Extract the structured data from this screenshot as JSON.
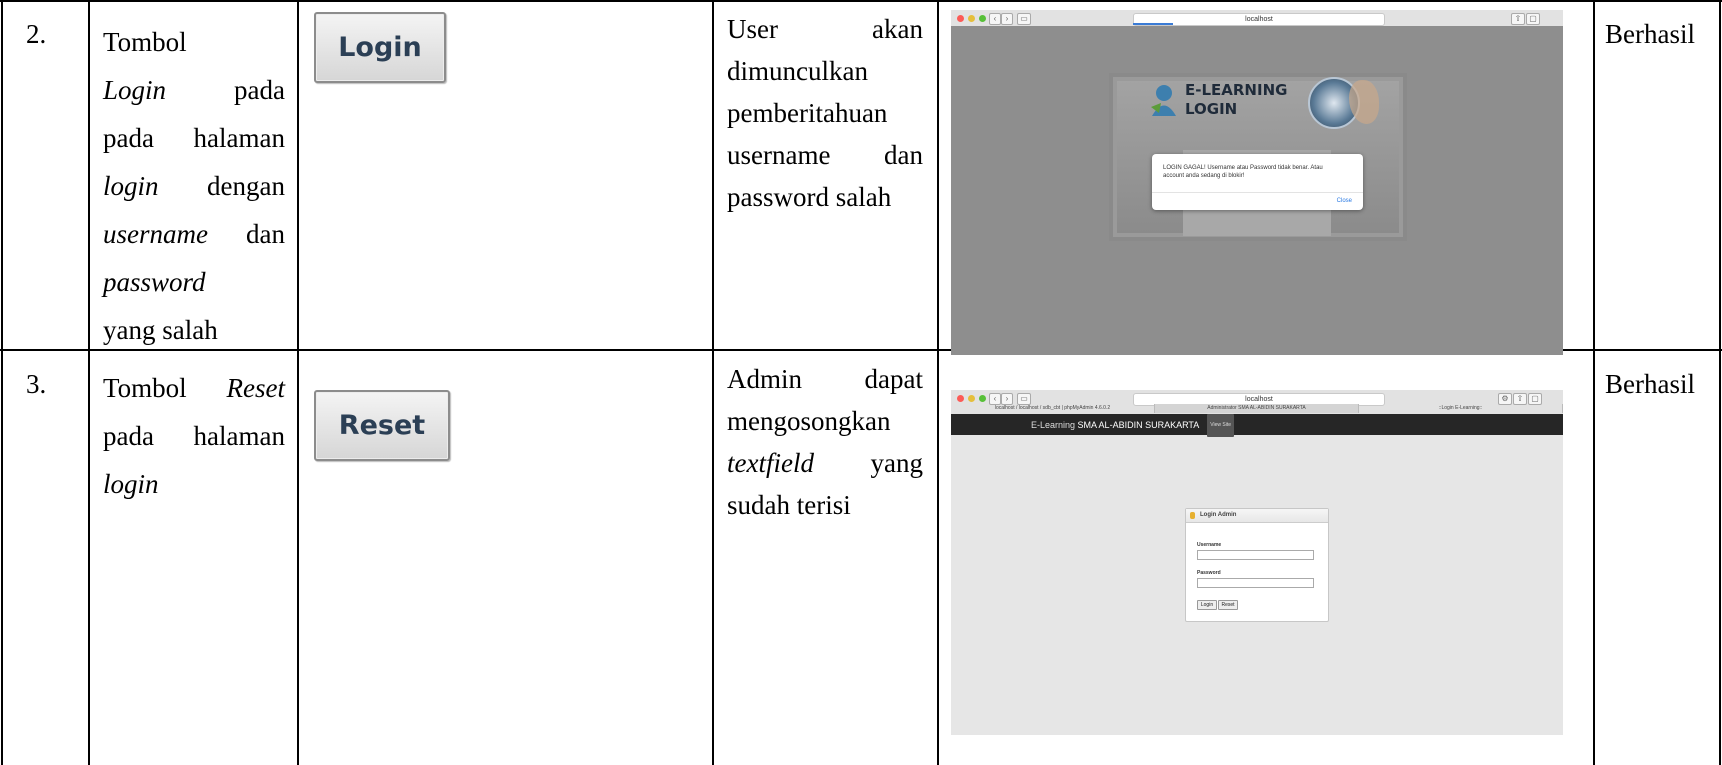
{
  "rows": [
    {
      "number": "2.",
      "test_case": {
        "line1": "Tombol",
        "line2_em": "Login",
        "line2_rest": "pada",
        "line3": "pada halaman",
        "line4_em": "login",
        "line4_rest": "dengan",
        "line5_em": "username",
        "line5_rest": "dan",
        "line6_em": "password",
        "line7": "yang salah"
      },
      "button_image_label": "Login",
      "expected": {
        "line1a": "User",
        "line1b": "akan",
        "line2": "dimunculkan",
        "line3": "pemberitahuan",
        "line4a": "username",
        "line4b": "dan",
        "line5": "password salah"
      },
      "screenshot": {
        "url": "localhost",
        "logo_line1": "E-LEARNING",
        "logo_line2": "LOGIN",
        "alert_message": "LOGIN GAGAL! Username atau Password tidak benar. Atau account anda sedang di blokir!",
        "alert_close": "Close"
      },
      "result": "Berhasil"
    },
    {
      "number": "3.",
      "test_case": {
        "line1_plain": "Tombol",
        "line1_em": "Reset",
        "line2": "pada halaman",
        "line3_em": "login"
      },
      "button_image_label": "Reset",
      "expected": {
        "line1a": "Admin",
        "line1b": "dapat",
        "line2": "mengosongkan",
        "line3_em": "textfield",
        "line3_rest": "yang",
        "line4": "sudah terisi"
      },
      "screenshot": {
        "url": "localhost",
        "tabs": [
          "localhost / localhost / sdb_cbt | phpMyAdmin 4.6.0.2",
          "Administrator SMA AL-ABIDIN SURAKARTA",
          "::Login E-Learning::"
        ],
        "header_prefix": "E-Learning",
        "header_school": "SMA AL-ABIDIN SURAKARTA",
        "view_site": "View Site",
        "card_title": "Login Admin",
        "username_label": "Username",
        "password_label": "Password",
        "login_button": "Login",
        "reset_button": "Reset"
      },
      "result": "Berhasil"
    }
  ],
  "colors": {
    "dialog_link": "#2a7ae4",
    "admin_bar": "#262626",
    "alert_bg": "#ffffff"
  }
}
